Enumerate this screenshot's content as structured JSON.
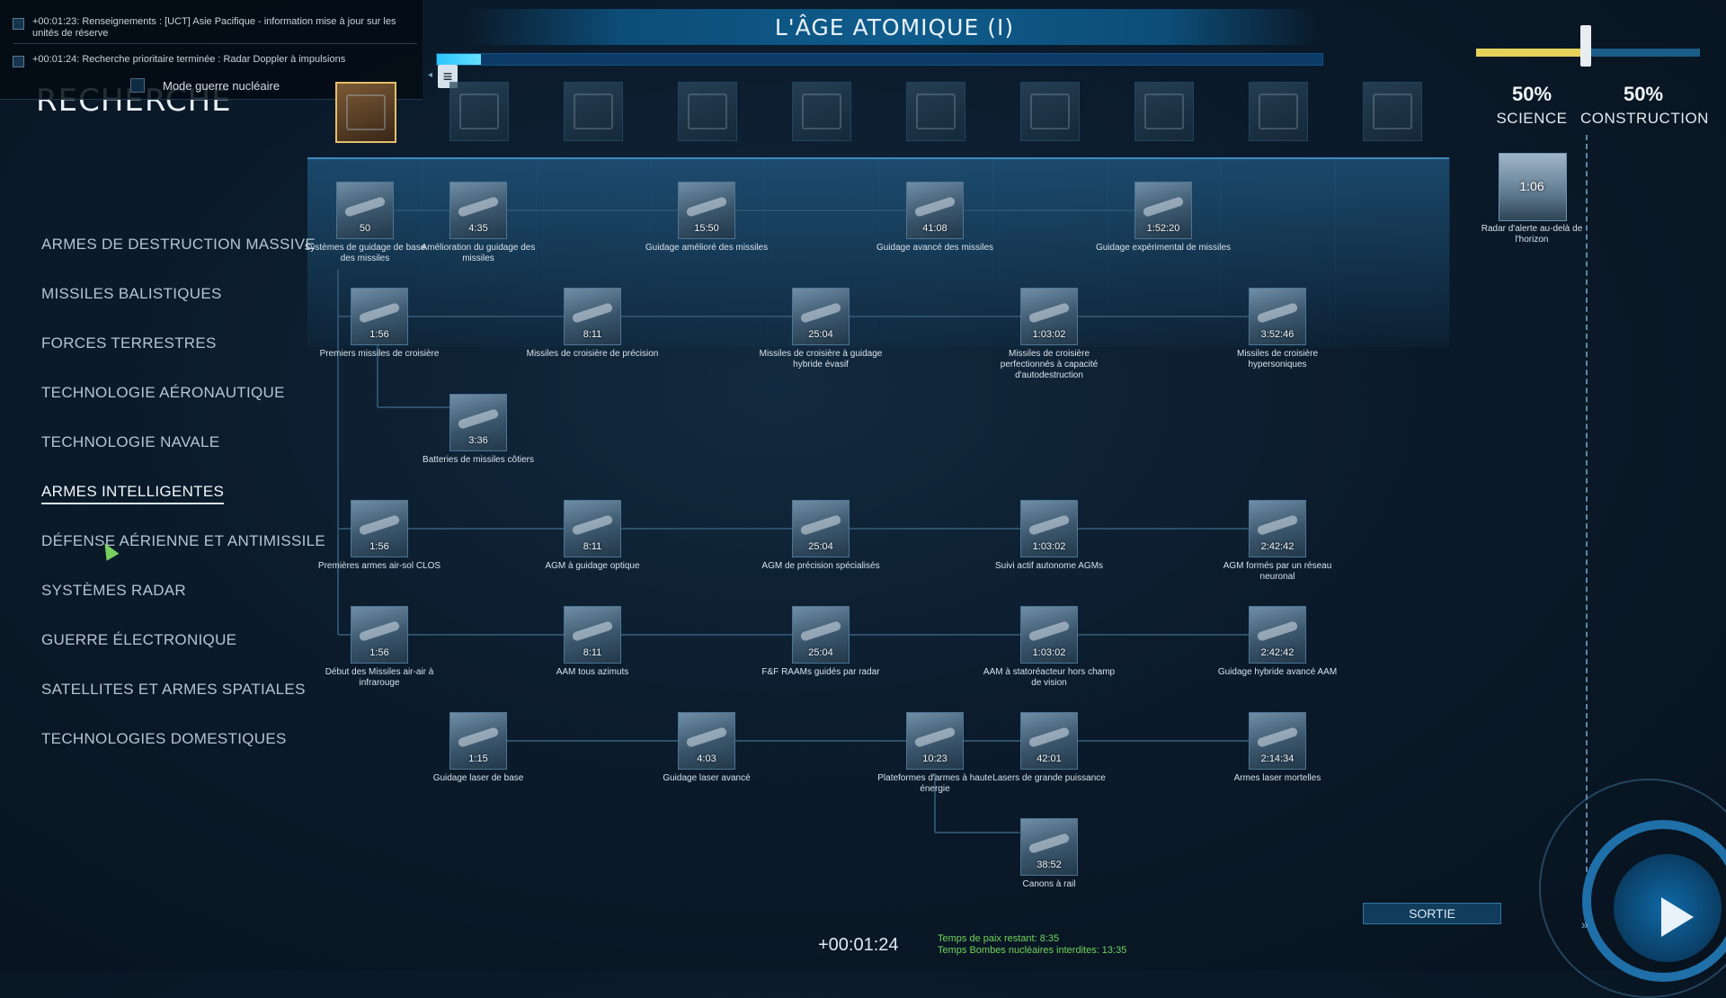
{
  "notifications": [
    {
      "text": "+00:01:23: Renseignements : [UCT] Asie Pacifique - information mise à jour sur les unités de réserve"
    },
    {
      "text": "+00:01:24: Recherche prioritaire terminée : Radar Doppler à impulsions"
    }
  ],
  "nuclear_war_mode_label": "Mode guerre nucléaire",
  "page_title": "RECHERCHE",
  "era": {
    "title": "L'ÂGE ATOMIQUE (I)",
    "progress_fraction": 0.05
  },
  "categories": [
    {
      "label": "ARMES DE DESTRUCTION MASSIVE",
      "active": false
    },
    {
      "label": "MISSILES BALISTIQUES",
      "active": false
    },
    {
      "label": "FORCES TERRESTRES",
      "active": false
    },
    {
      "label": "TECHNOLOGIE AÉRONAUTIQUE",
      "active": false
    },
    {
      "label": "TECHNOLOGIE NAVALE",
      "active": false
    },
    {
      "label": "ARMES INTELLIGENTES",
      "active": true
    },
    {
      "label": "DÉFENSE AÉRIENNE ET ANTIMISSILE",
      "active": false
    },
    {
      "label": "SYSTÈMES RADAR",
      "active": false
    },
    {
      "label": "GUERRE ÉLECTRONIQUE",
      "active": false
    },
    {
      "label": "SATELLITES ET ARMES SPATIALES",
      "active": false
    },
    {
      "label": "TECHNOLOGIES DOMESTIQUES",
      "active": false
    }
  ],
  "era_thumbnails": [
    "radio",
    "cassette-player",
    "oscilloscope",
    "circuit-board",
    "desktop-computer",
    "laptop",
    "smartphone",
    "smartwatch",
    "drone",
    "futuristic"
  ],
  "techs": [
    {
      "time": "50",
      "label": "Systèmes de guidage de base des missiles"
    },
    {
      "time": "4:35",
      "label": "Amélioration du guidage des missiles"
    },
    {
      "time": "15:50",
      "label": "Guidage amélioré des missiles"
    },
    {
      "time": "41:08",
      "label": "Guidage avancé des missiles"
    },
    {
      "time": "1:52:20",
      "label": "Guidage expérimental de missiles"
    },
    {
      "time": "1:56",
      "label": "Premiers missiles de croisière"
    },
    {
      "time": "8:11",
      "label": "Missiles de croisière de précision"
    },
    {
      "time": "25:04",
      "label": "Missiles de croisière à guidage hybride évasif"
    },
    {
      "time": "1:03:02",
      "label": "Missiles de croisière perfectionnés à capacité d'autodestruction"
    },
    {
      "time": "3:52:46",
      "label": "Missiles de croisière hypersoniques"
    },
    {
      "time": "3:36",
      "label": "Batteries de missiles côtiers"
    },
    {
      "time": "1:56",
      "label": "Premières armes air-sol CLOS"
    },
    {
      "time": "8:11",
      "label": "AGM à guidage optique"
    },
    {
      "time": "25:04",
      "label": "AGM de précision spécialisés"
    },
    {
      "time": "1:03:02",
      "label": "Suivi actif autonome AGMs"
    },
    {
      "time": "2:42:42",
      "label": "AGM formés par un réseau neuronal"
    },
    {
      "time": "1:56",
      "label": "Début des Missiles air-air à infrarouge"
    },
    {
      "time": "8:11",
      "label": "AAM tous azimuts"
    },
    {
      "time": "25:04",
      "label": "F&F RAAMs guidés par radar"
    },
    {
      "time": "1:03:02",
      "label": "AAM à statoréacteur hors champ de vision"
    },
    {
      "time": "2:42:42",
      "label": "Guidage hybride avancé AAM"
    },
    {
      "time": "1:15",
      "label": "Guidage laser de base"
    },
    {
      "time": "4:03",
      "label": "Guidage laser avancé"
    },
    {
      "time": "10:23",
      "label": "Plateformes d'armes à haute énergie"
    },
    {
      "time": "42:01",
      "label": "Lasers de grande puissance"
    },
    {
      "time": "2:14:34",
      "label": "Armes laser mortelles"
    },
    {
      "time": "38:52",
      "label": "Canons à rail"
    }
  ],
  "budget": {
    "science_pct": "50%",
    "science_label": "SCIENCE",
    "construction_pct": "50%",
    "construction_label": "CONSTRUCTION",
    "science_fraction": 0.5
  },
  "queue": {
    "time": "1:06",
    "label": "Radar d'alerte au-delà de l'horizon"
  },
  "clock": "+00:01:24",
  "peace_info": [
    "Temps de paix restant: 8:35",
    "Temps Bombes nucléaires interdites: 13:35"
  ],
  "exit_label": "SORTIE",
  "colors": {
    "accent": "#2bc4ff",
    "science": "#e6d25b",
    "construction": "#1c5c88",
    "peace_text": "#6fd35a"
  }
}
